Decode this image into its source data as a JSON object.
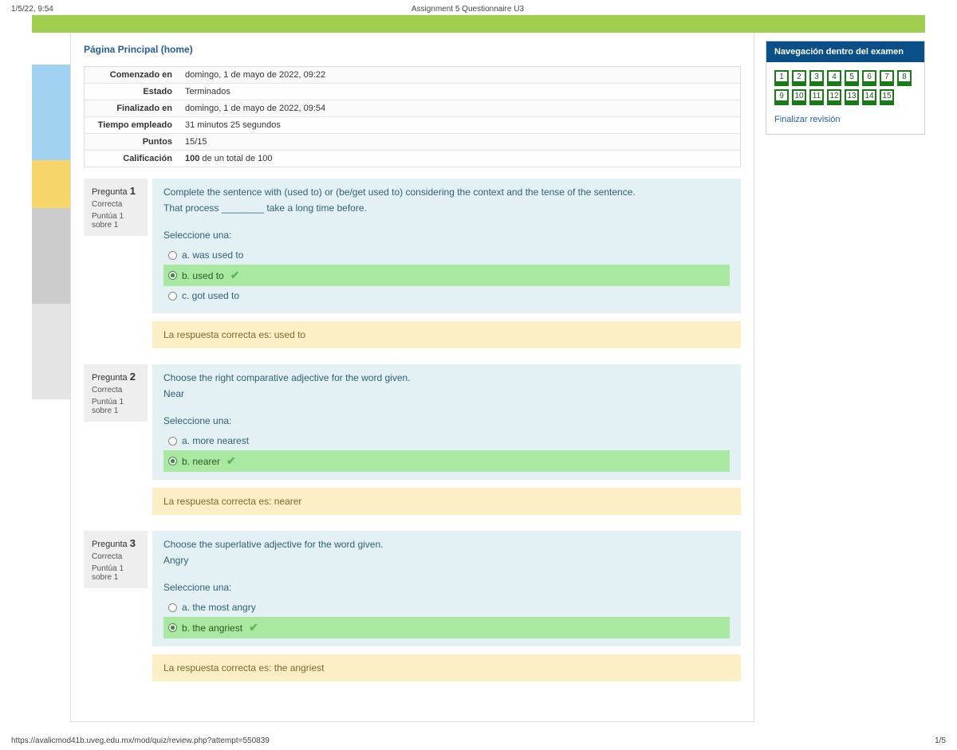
{
  "print": {
    "datetime": "1/5/22, 9:54",
    "title": "Assignment 5 Questionnaire U3",
    "url": "https://avalicmod41b.uveg.edu.mx/mod/quiz/review.php?attempt=550839",
    "page": "1/5"
  },
  "breadcrumb": {
    "home": "Página Principal (home)"
  },
  "summary": {
    "rows": [
      {
        "label": "Comenzado en",
        "value": "domingo, 1 de mayo de 2022, 09:22"
      },
      {
        "label": "Estado",
        "value": "Terminados"
      },
      {
        "label": "Finalizado en",
        "value": "domingo, 1 de mayo de 2022, 09:54"
      },
      {
        "label": "Tiempo empleado",
        "value": "31 minutos 25 segundos"
      },
      {
        "label": "Puntos",
        "value": "15/15"
      },
      {
        "label": "Calificación",
        "value_strong": "100",
        "value_rest": " de un total de 100"
      }
    ]
  },
  "labels": {
    "question_word": "Pregunta",
    "correct": "Correcta",
    "mark": "Puntúa 1 sobre 1",
    "select_one": "Seleccione una:",
    "feedback_prefix": "La respuesta correcta es: "
  },
  "questions": [
    {
      "num": "1",
      "prompt1": "Complete the sentence with (used to) or (be/get used to) considering the context and the tense of the sentence.",
      "prompt2": "That process ________ take a long time before.",
      "options": [
        {
          "letter": "a.",
          "text": "was used to",
          "selected": false
        },
        {
          "letter": "b.",
          "text": "used to",
          "selected": true
        },
        {
          "letter": "c.",
          "text": "got used to",
          "selected": false
        }
      ],
      "answer": "used to"
    },
    {
      "num": "2",
      "prompt1": "Choose the right comparative adjective for the word given.",
      "prompt2": "Near",
      "options": [
        {
          "letter": "a.",
          "text": "more nearest",
          "selected": false
        },
        {
          "letter": "b.",
          "text": "nearer",
          "selected": true
        }
      ],
      "answer": "nearer"
    },
    {
      "num": "3",
      "prompt1": "Choose the superlative adjective for the word given.",
      "prompt2": "Angry",
      "options": [
        {
          "letter": "a.",
          "text": "the most angry",
          "selected": false
        },
        {
          "letter": "b.",
          "text": "the angriest",
          "selected": true
        }
      ],
      "answer": "the angriest"
    }
  ],
  "nav": {
    "title": "Navegación dentro del examen",
    "items": [
      "1",
      "2",
      "3",
      "4",
      "5",
      "6",
      "7",
      "8",
      "9",
      "10",
      "11",
      "12",
      "13",
      "14",
      "15"
    ],
    "finish": "Finalizar revisión"
  }
}
